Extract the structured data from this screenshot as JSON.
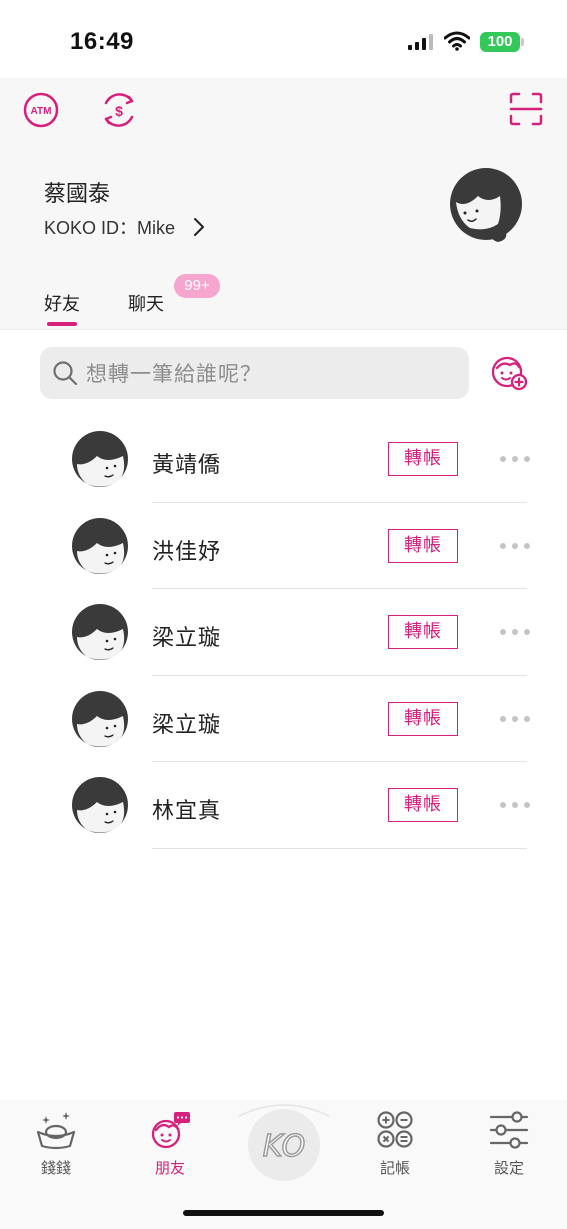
{
  "status_bar": {
    "time": "16:49",
    "battery": "100"
  },
  "header": {
    "atm_icon_text": "ATM",
    "user_name": "蔡國泰",
    "koko_id": "KOKO ID：Mike"
  },
  "tabs": [
    {
      "label": "好友",
      "active": true
    },
    {
      "label": "聊天",
      "badge": "99+"
    }
  ],
  "search": {
    "placeholder": "想轉一筆給誰呢？"
  },
  "friends": [
    {
      "name": "黃靖僑",
      "action": "轉帳"
    },
    {
      "name": "洪佳妤",
      "action": "轉帳"
    },
    {
      "name": "梁立璇",
      "action": "轉帳"
    },
    {
      "name": "梁立璇",
      "action": "轉帳"
    },
    {
      "name": "林宜真",
      "action": "轉帳"
    }
  ],
  "bottom_nav": {
    "money": "錢錢",
    "friends": "朋友",
    "center": "KO",
    "ledger": "記帳",
    "settings": "設定"
  },
  "colors": {
    "accent": "#d6207c",
    "badge": "#f6a5ce",
    "battery": "#34c759"
  }
}
